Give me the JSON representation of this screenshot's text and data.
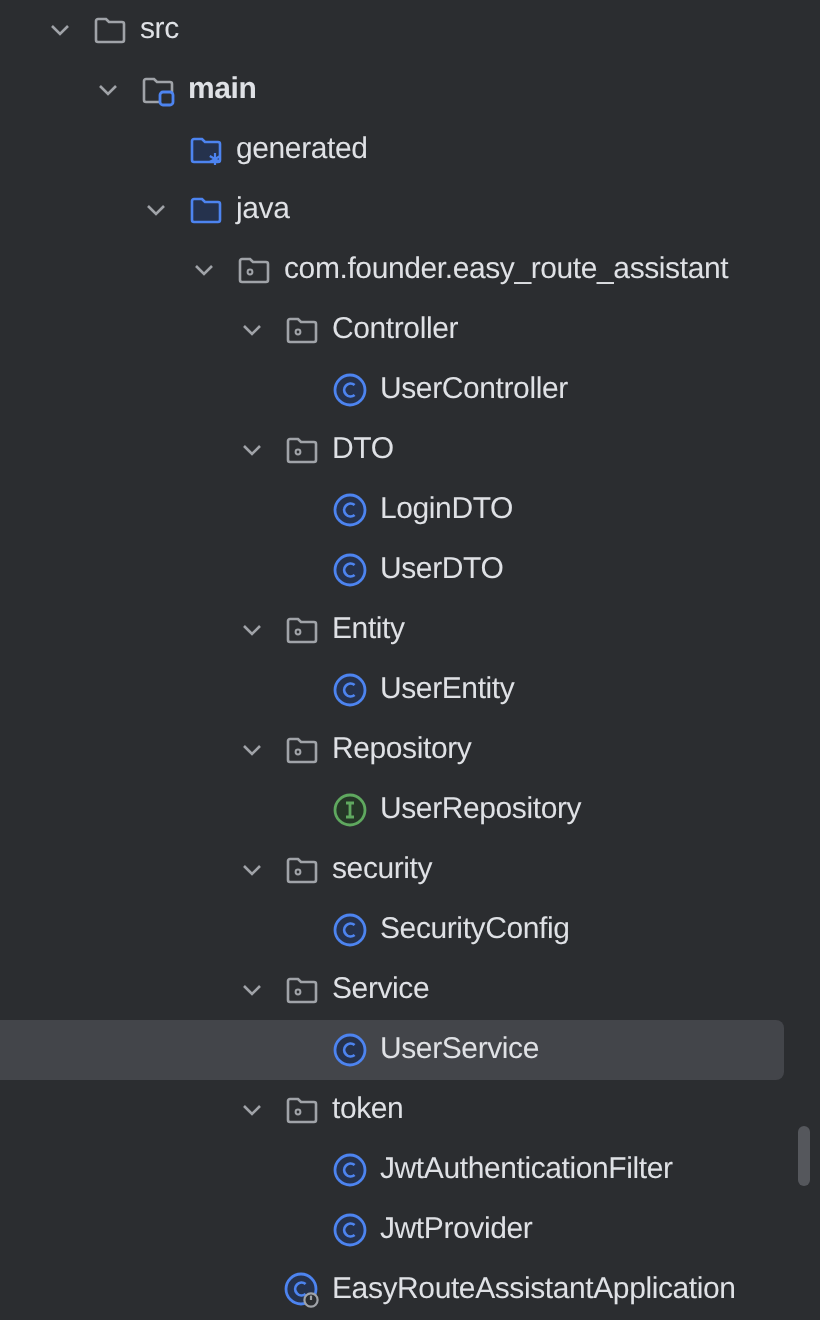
{
  "tree": [
    {
      "label": "src",
      "kind": "folder",
      "expanded": true,
      "selected": false,
      "children": [
        {
          "label": "main",
          "kind": "module",
          "expanded": true,
          "selected": false,
          "children": [
            {
              "label": "generated",
              "kind": "generated",
              "selected": false
            },
            {
              "label": "java",
              "kind": "source",
              "expanded": true,
              "selected": false,
              "children": [
                {
                  "label": "com.founder.easy_route_assistant",
                  "kind": "package",
                  "expanded": true,
                  "selected": false,
                  "children": [
                    {
                      "label": "Controller",
                      "kind": "package",
                      "expanded": true,
                      "selected": false,
                      "children": [
                        {
                          "label": "UserController",
                          "kind": "class",
                          "selected": false
                        }
                      ]
                    },
                    {
                      "label": "DTO",
                      "kind": "package",
                      "expanded": true,
                      "selected": false,
                      "children": [
                        {
                          "label": "LoginDTO",
                          "kind": "class",
                          "selected": false
                        },
                        {
                          "label": "UserDTO",
                          "kind": "class",
                          "selected": false
                        }
                      ]
                    },
                    {
                      "label": "Entity",
                      "kind": "package",
                      "expanded": true,
                      "selected": false,
                      "children": [
                        {
                          "label": "UserEntity",
                          "kind": "class",
                          "selected": false
                        }
                      ]
                    },
                    {
                      "label": "Repository",
                      "kind": "package",
                      "expanded": true,
                      "selected": false,
                      "children": [
                        {
                          "label": "UserRepository",
                          "kind": "interface",
                          "selected": false
                        }
                      ]
                    },
                    {
                      "label": "security",
                      "kind": "package",
                      "expanded": true,
                      "selected": false,
                      "children": [
                        {
                          "label": "SecurityConfig",
                          "kind": "class",
                          "selected": false
                        }
                      ]
                    },
                    {
                      "label": "Service",
                      "kind": "package",
                      "expanded": true,
                      "selected": false,
                      "children": [
                        {
                          "label": "UserService",
                          "kind": "class",
                          "selected": true
                        }
                      ]
                    },
                    {
                      "label": "token",
                      "kind": "package",
                      "expanded": true,
                      "selected": false,
                      "children": [
                        {
                          "label": "JwtAuthenticationFilter",
                          "kind": "class",
                          "selected": false
                        },
                        {
                          "label": "JwtProvider",
                          "kind": "class",
                          "selected": false
                        }
                      ]
                    },
                    {
                      "label": "EasyRouteAssistantApplication",
                      "kind": "app",
                      "selected": false
                    }
                  ]
                }
              ]
            }
          ]
        }
      ]
    }
  ]
}
